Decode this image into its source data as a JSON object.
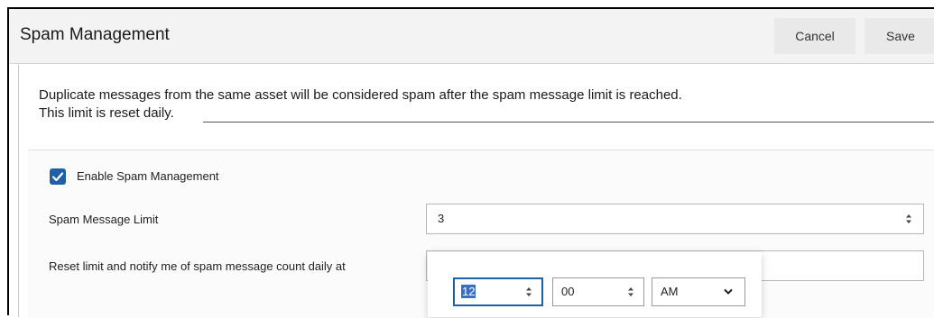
{
  "header": {
    "title": "Spam Management",
    "cancel_label": "Cancel",
    "save_label": "Save"
  },
  "description": {
    "line1": "Duplicate messages from the same asset will be considered spam after the spam message limit is reached.",
    "line2": "This limit is reset daily."
  },
  "enable": {
    "label": "Enable Spam Management",
    "checked": true
  },
  "limit": {
    "label": "Spam Message Limit",
    "value": "3"
  },
  "reset": {
    "label": "Reset limit and notify me of spam message count daily at",
    "hours": "12",
    "minutes": "00",
    "period": "AM"
  },
  "colors": {
    "accent": "#1f5fa8",
    "header_bg": "#f3f3f3"
  },
  "icons": {
    "checkbox": "check-icon",
    "stepper": "stepper-arrows-icon",
    "dropdown": "chevron-down-icon"
  }
}
